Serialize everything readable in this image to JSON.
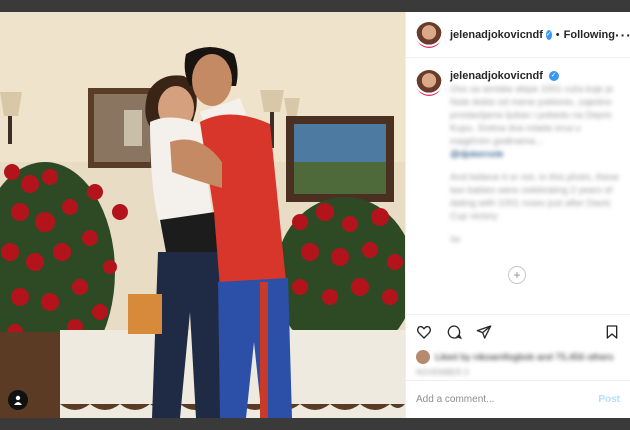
{
  "post": {
    "username": "jelenadjokovicndf",
    "follow_status": "Following",
    "dot": "•",
    "more_icon": "more-horizontal-icon",
    "caption_lines": [
      "Ovo sa tenisk",
      "fotografija...",
      "Jelena i Novak"
    ],
    "caption_visible_text": "And believe it or not, in this photo, these two babies were celebrating 2 years of dating with 1001 roses just after Davis Cup victory",
    "mention": "@djokernole",
    "loader_icon": "plus-circle-icon",
    "likes_text": "Liked by",
    "add_comment_placeholder": "Add a comment...",
    "post_button": "Post"
  },
  "colors": {
    "frame": "#3a3a3a",
    "accent": "#3897f0",
    "post_disabled": "#b2dffc"
  }
}
